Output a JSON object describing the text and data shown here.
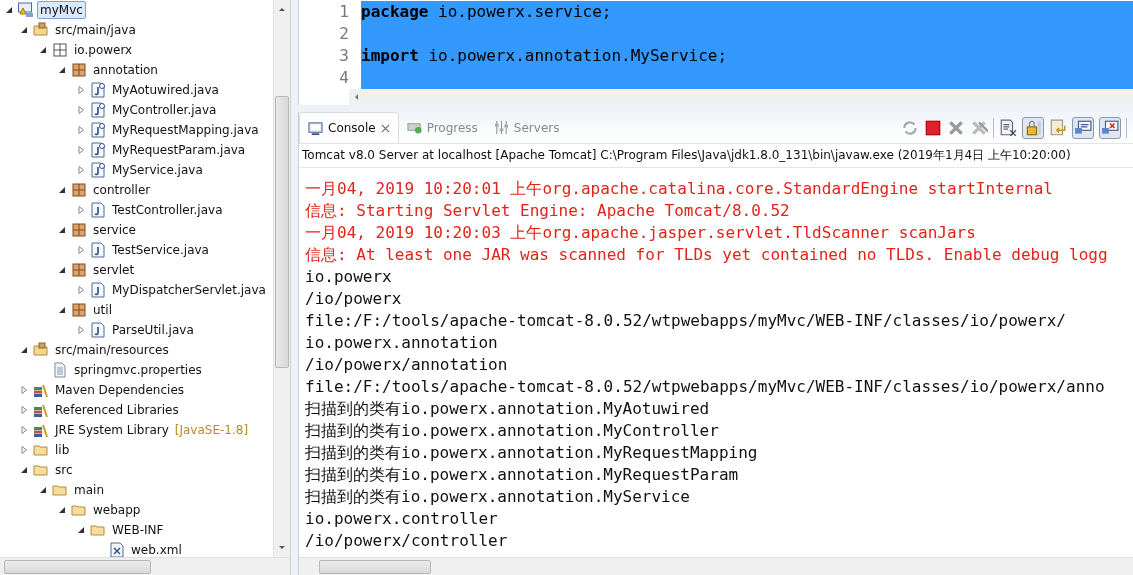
{
  "explorer": {
    "tree": [
      {
        "label": "myMvc",
        "kind": "project",
        "expanded": true,
        "selected": true,
        "children": [
          {
            "label": "src/main/java",
            "kind": "srcfolder",
            "expanded": true,
            "selected": false,
            "children": [
              {
                "label": "io.powerx",
                "kind": "package-root",
                "expanded": true,
                "selected": false,
                "children": [
                  {
                    "label": "annotation",
                    "kind": "package",
                    "expanded": true,
                    "selected": false,
                    "children": [
                      {
                        "label": "MyAotuwired.java",
                        "kind": "annotation-file",
                        "expanded": false,
                        "selected": false
                      },
                      {
                        "label": "MyController.java",
                        "kind": "annotation-file",
                        "expanded": false,
                        "selected": false
                      },
                      {
                        "label": "MyRequestMapping.java",
                        "kind": "annotation-file",
                        "expanded": false,
                        "selected": false
                      },
                      {
                        "label": "MyRequestParam.java",
                        "kind": "annotation-file",
                        "expanded": false,
                        "selected": false
                      },
                      {
                        "label": "MyService.java",
                        "kind": "annotation-file",
                        "expanded": false,
                        "selected": false
                      }
                    ]
                  },
                  {
                    "label": "controller",
                    "kind": "package",
                    "expanded": true,
                    "selected": false,
                    "children": [
                      {
                        "label": "TestController.java",
                        "kind": "java-file",
                        "expanded": false,
                        "selected": false
                      }
                    ]
                  },
                  {
                    "label": "service",
                    "kind": "package",
                    "expanded": true,
                    "selected": false,
                    "children": [
                      {
                        "label": "TestService.java",
                        "kind": "java-file",
                        "expanded": false,
                        "selected": false
                      }
                    ]
                  },
                  {
                    "label": "servlet",
                    "kind": "package",
                    "expanded": true,
                    "selected": false,
                    "children": [
                      {
                        "label": "MyDispatcherServlet.java",
                        "kind": "java-file",
                        "expanded": false,
                        "selected": false
                      }
                    ]
                  },
                  {
                    "label": "util",
                    "kind": "package",
                    "expanded": true,
                    "selected": false,
                    "children": [
                      {
                        "label": "ParseUtil.java",
                        "kind": "java-file",
                        "expanded": false,
                        "selected": false
                      }
                    ]
                  }
                ]
              }
            ]
          },
          {
            "label": "src/main/resources",
            "kind": "srcfolder",
            "expanded": true,
            "selected": false,
            "children": [
              {
                "label": "springmvc.properties",
                "kind": "text-file",
                "selected": false
              }
            ]
          },
          {
            "label": "Maven Dependencies",
            "kind": "library",
            "expanded": false,
            "selected": false
          },
          {
            "label": "Referenced Libraries",
            "kind": "library",
            "expanded": false,
            "selected": false
          },
          {
            "label": "JRE System Library",
            "decoration": "[JavaSE-1.8]",
            "kind": "library",
            "expanded": false,
            "selected": false
          },
          {
            "label": "lib",
            "kind": "folder",
            "expanded": false,
            "selected": false
          },
          {
            "label": "src",
            "kind": "folder",
            "expanded": true,
            "selected": false,
            "children": [
              {
                "label": "main",
                "kind": "folder",
                "expanded": true,
                "selected": false,
                "children": [
                  {
                    "label": "webapp",
                    "kind": "folder",
                    "expanded": true,
                    "selected": false,
                    "children": [
                      {
                        "label": "WEB-INF",
                        "kind": "folder",
                        "expanded": true,
                        "selected": false,
                        "children": [
                          {
                            "label": "web.xml",
                            "kind": "xml-file",
                            "selected": false
                          }
                        ]
                      }
                    ]
                  }
                ]
              }
            ]
          }
        ]
      }
    ]
  },
  "editor": {
    "lines": [
      {
        "number": "1",
        "code": "**package** io.powerx.service;",
        "selected": true
      },
      {
        "number": "2",
        "selected": true
      },
      {
        "number": "3",
        "code": "**import** io.powerx.annotation.MyService;",
        "selected": true
      },
      {
        "number": "4",
        "selected": true
      }
    ]
  },
  "console": {
    "tabs": [
      {
        "label": "Console",
        "kind": "console",
        "selected": true,
        "closable": true
      },
      {
        "label": "Progress",
        "kind": "progress",
        "selected": false
      },
      {
        "label": "Servers",
        "kind": "servers",
        "selected": false
      }
    ],
    "title": "Tomcat v8.0 Server at localhost [Apache Tomcat] C:\\Program Files\\Java\\jdk1.8.0_131\\bin\\javaw.exe (2019年1月4日 上午10:20:00)",
    "lines": [
      {
        "text": "一月04, 2019 10:20:01 上午org.apache.catalina.core.StandardEngine startInternal",
        "kind": "err"
      },
      {
        "text": "信息: Starting Servlet Engine: Apache Tomcat/8.0.52",
        "kind": "err"
      },
      {
        "text": "一月04, 2019 10:20:03 上午org.apache.jasper.servlet.TldScanner scanJars",
        "kind": "err"
      },
      {
        "text": "信息: At least one JAR was scanned for TLDs yet contained no TLDs. Enable debug logg",
        "kind": "err"
      },
      {
        "text": "io.powerx",
        "kind": "out"
      },
      {
        "text": "/io/powerx",
        "kind": "out"
      },
      {
        "text": "file:/F:/tools/apache-tomcat-8.0.52/wtpwebapps/myMvc/WEB-INF/classes/io/powerx/",
        "kind": "out"
      },
      {
        "text": "io.powerx.annotation",
        "kind": "out"
      },
      {
        "text": "/io/powerx/annotation",
        "kind": "out"
      },
      {
        "text": "file:/F:/tools/apache-tomcat-8.0.52/wtpwebapps/myMvc/WEB-INF/classes/io/powerx/anno",
        "kind": "out"
      },
      {
        "text": "扫描到的类有io.powerx.annotation.MyAotuwired",
        "kind": "out"
      },
      {
        "text": "扫描到的类有io.powerx.annotation.MyController",
        "kind": "out"
      },
      {
        "text": "扫描到的类有io.powerx.annotation.MyRequestMapping",
        "kind": "out"
      },
      {
        "text": "扫描到的类有io.powerx.annotation.MyRequestParam",
        "kind": "out"
      },
      {
        "text": "扫描到的类有io.powerx.annotation.MyService",
        "kind": "out"
      },
      {
        "text": "io.powerx.controller",
        "kind": "out"
      },
      {
        "text": "/io/powerx/controller",
        "kind": "out"
      }
    ]
  }
}
